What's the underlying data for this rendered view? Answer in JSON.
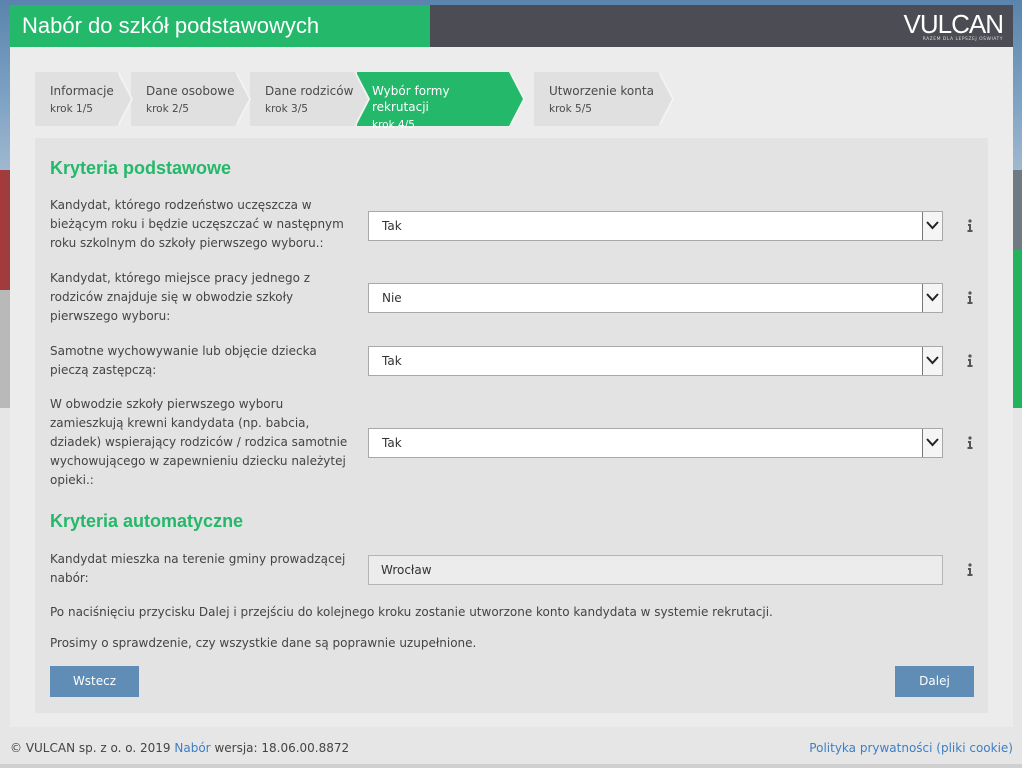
{
  "header": {
    "title": "Nabór do szkół podstawowych",
    "logo_text": "VULCAN",
    "logo_tagline": "RAZEM DLA LEPSZEJ OŚWIATY"
  },
  "steps": [
    {
      "label": "Informacje",
      "step": "krok 1/5",
      "active": false
    },
    {
      "label": "Dane osobowe",
      "step": "krok 2/5",
      "active": false
    },
    {
      "label": "Dane rodziców",
      "step": "krok 3/5",
      "active": false
    },
    {
      "label": "Wybór formy rekrutacji",
      "step": "krok 4/5",
      "active": true
    },
    {
      "label": "Utworzenie konta",
      "step": "krok 5/5",
      "active": false
    }
  ],
  "basic": {
    "heading": "Kryteria podstawowe",
    "items": [
      {
        "label": "Kandydat, którego rodzeństwo uczęszcza w bieżącym roku i będzie uczęszczać w następnym roku szkolnym do szkoły pierwszego wyboru.:",
        "value": "Tak"
      },
      {
        "label": "Kandydat, którego miejsce pracy jednego z rodziców znajduje się w obwodzie szkoły pierwszego wyboru:",
        "value": "Nie"
      },
      {
        "label": "Samotne wychowywanie lub objęcie dziecka pieczą zastępczą:",
        "value": "Tak"
      },
      {
        "label": "W obwodzie szkoły pierwszego wyboru zamieszkują krewni kandydata (np. babcia, dziadek) wspierający rodziców / rodzica samotnie wychowującego w zapewnieniu dziecku należytej opieki.:",
        "value": "Tak"
      }
    ]
  },
  "automatic": {
    "heading": "Kryteria automatyczne",
    "items": [
      {
        "label": "Kandydat mieszka na terenie gminy prowadzącej nabór:",
        "value": "Wrocław"
      }
    ]
  },
  "notes": [
    "Po naciśnięciu przycisku Dalej i przejściu do kolejnego kroku zostanie utworzone konto kandydata w systemie rekrutacji.",
    "Prosimy o sprawdzenie, czy wszystkie dane są poprawnie uzupełnione."
  ],
  "buttons": {
    "back": "Wstecz",
    "next": "Dalej"
  },
  "footer": {
    "copyright": "© VULCAN sp. z o. o. 2019",
    "app_link": "Nabór",
    "version": "wersja: 18.06.00.8872",
    "privacy_link": "Polityka prywatności (pliki cookie)"
  },
  "colors": {
    "brand_green": "#23b86a",
    "button_blue": "#5f8db5",
    "topbar": "#4c4c55",
    "link": "#3d7ec6"
  }
}
